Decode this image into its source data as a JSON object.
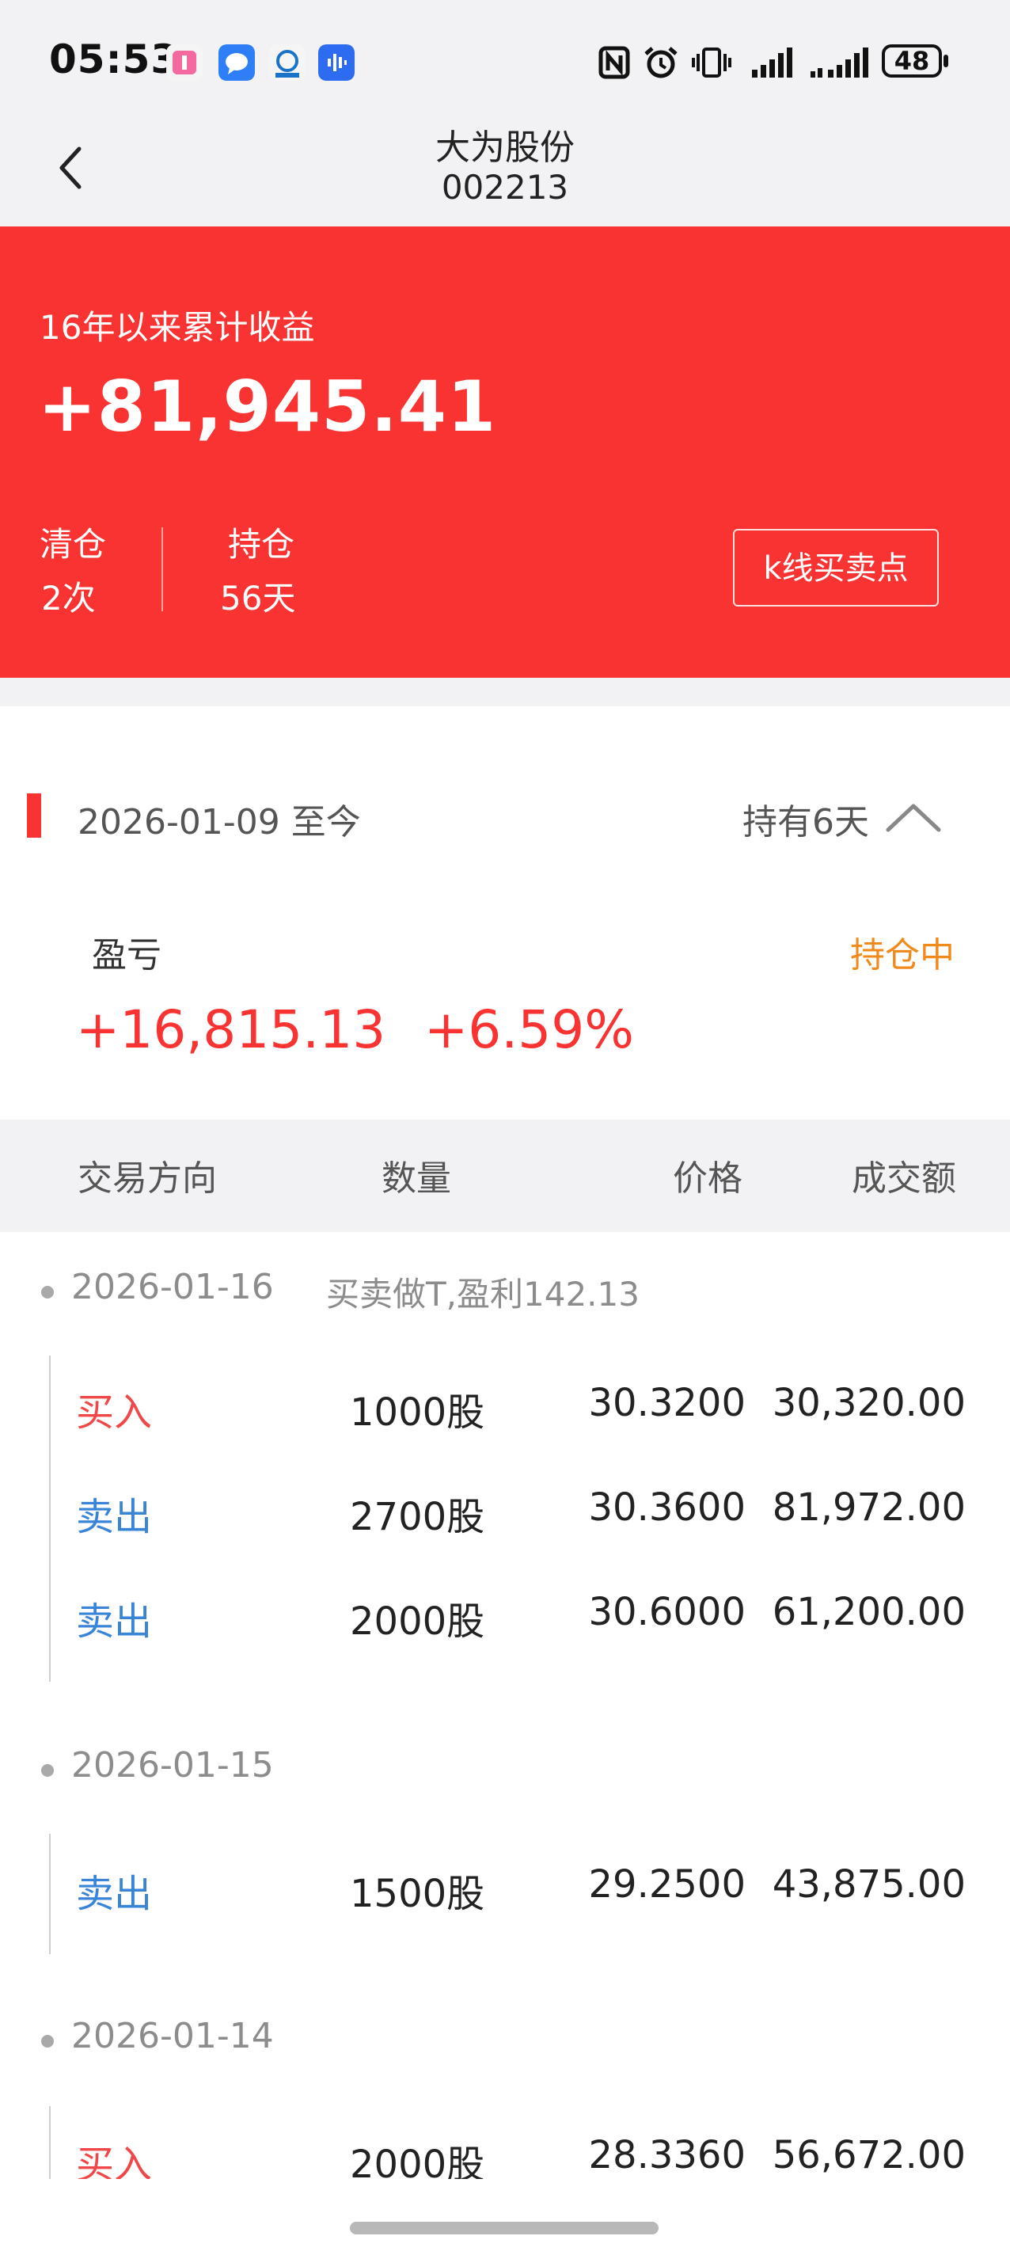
{
  "status_bar": {
    "time": "05:53",
    "battery": "48",
    "icons": [
      "notification-app-icon",
      "chat-app-icon",
      "cs-app-icon",
      "voice-app-icon",
      "nfc-icon",
      "alarm-icon",
      "vibrate-icon",
      "signal-icon",
      "signal-icon-2",
      "battery-icon"
    ]
  },
  "nav": {
    "title": "大为股份",
    "code": "002213",
    "back_icon": "chevron-left-icon"
  },
  "summary": {
    "label": "16年以来累计收益",
    "value": "+81,945.41",
    "clear_label": "清仓",
    "clear_value": "2次",
    "hold_label": "持仓",
    "hold_value": "56天",
    "kline_button": "k线买卖点"
  },
  "period": {
    "range": "2026-01-09 至今",
    "days": "持有6天",
    "toggle_icon": "chevron-up-icon"
  },
  "pl": {
    "label": "盈亏",
    "status": "持仓中",
    "amount": "+16,815.13",
    "percent": "+6.59%"
  },
  "table": {
    "headers": [
      "交易方向",
      "数量",
      "价格",
      "成交额"
    ]
  },
  "groups": [
    {
      "date": "2026-01-16",
      "note": "买卖做T,盈利142.13",
      "rows": [
        {
          "dir": "买入",
          "qty": "1000股",
          "price": "30.3200",
          "amount": "30,320.00"
        },
        {
          "dir": "卖出",
          "qty": "2700股",
          "price": "30.3600",
          "amount": "81,972.00"
        },
        {
          "dir": "卖出",
          "qty": "2000股",
          "price": "30.6000",
          "amount": "61,200.00"
        }
      ]
    },
    {
      "date": "2026-01-15",
      "note": "",
      "rows": [
        {
          "dir": "卖出",
          "qty": "1500股",
          "price": "29.2500",
          "amount": "43,875.00"
        }
      ]
    },
    {
      "date": "2026-01-14",
      "note": "",
      "rows": [
        {
          "dir": "买入",
          "qty": "2000股",
          "price": "28.3360",
          "amount": "56,672.00"
        }
      ]
    }
  ],
  "colors": {
    "accent_red": "#f93232",
    "buy": "#f04848",
    "sell": "#3a84d8",
    "holding": "#f08a1c"
  }
}
